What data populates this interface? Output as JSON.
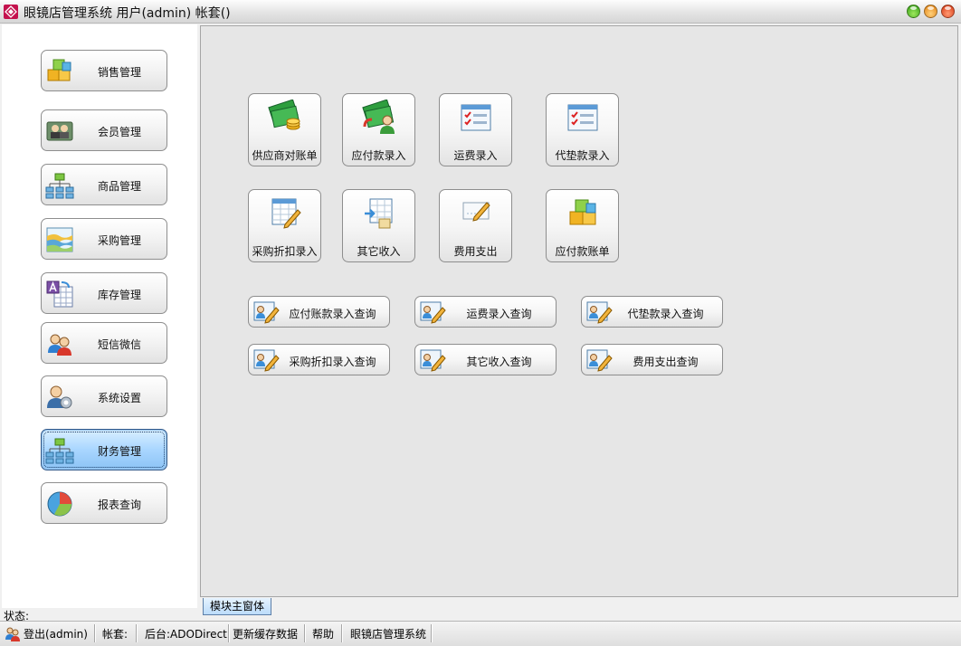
{
  "window": {
    "title": "眼镜店管理系统 用户(admin) 帐套()"
  },
  "sidebar": {
    "items": [
      {
        "label": "销售管理",
        "icon": "boxes-icon"
      },
      {
        "label": "会员管理",
        "icon": "members-icon"
      },
      {
        "label": "商品管理",
        "icon": "org-chart-icon"
      },
      {
        "label": "采购管理",
        "icon": "chart-layers-icon"
      },
      {
        "label": "库存管理",
        "icon": "inventory-icon"
      },
      {
        "label": "短信微信",
        "icon": "users-icon"
      },
      {
        "label": "系统设置",
        "icon": "user-settings-icon"
      },
      {
        "label": "财务管理",
        "icon": "org-chart-icon",
        "active": true
      },
      {
        "label": "报表查询",
        "icon": "pie-chart-icon"
      }
    ]
  },
  "main": {
    "tiles": [
      {
        "label": "供应商对账单",
        "icon": "money-coins-icon"
      },
      {
        "label": "应付款录入",
        "icon": "money-user-icon"
      },
      {
        "label": "运费录入",
        "icon": "checklist-icon"
      },
      {
        "label": "代垫款录入",
        "icon": "checklist-icon"
      },
      {
        "label": "采购折扣录入",
        "icon": "table-pencil-icon"
      },
      {
        "label": "其它收入",
        "icon": "table-import-icon"
      },
      {
        "label": "费用支出",
        "icon": "card-pencil-icon"
      },
      {
        "label": "应付款账单",
        "icon": "boxes-icon"
      }
    ],
    "query_buttons": [
      {
        "label": "应付账款录入查询",
        "icon": "id-card-edit-icon"
      },
      {
        "label": "运费录入查询",
        "icon": "id-card-edit-icon"
      },
      {
        "label": "代垫款录入查询",
        "icon": "id-card-edit-icon"
      },
      {
        "label": "采购折扣录入查询",
        "icon": "id-card-edit-icon"
      },
      {
        "label": "其它收入查询",
        "icon": "id-card-edit-icon"
      },
      {
        "label": "费用支出查询",
        "icon": "id-card-edit-icon"
      }
    ]
  },
  "tab": {
    "label": "模块主窗体"
  },
  "status": {
    "label": "状态:",
    "login": "登出(admin)",
    "account": "帐套:",
    "backend": "后台:ADODirect",
    "refresh": "更新缓存数据",
    "help": "帮助",
    "app_name": "眼镜店管理系统"
  },
  "colors": {
    "active_nav": "#a9d6ff",
    "main_bg": "#e6e6e6",
    "sidebar_bg": "#ffffff"
  }
}
